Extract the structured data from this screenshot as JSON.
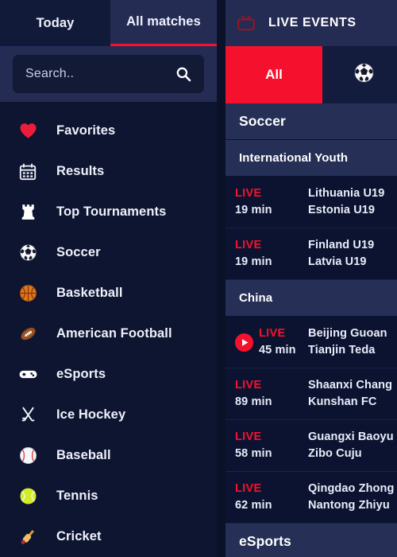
{
  "sidebar": {
    "tabs": [
      {
        "label": "Today",
        "active": false
      },
      {
        "label": "All matches",
        "active": true
      }
    ],
    "search": {
      "placeholder": "Search..",
      "value": "",
      "icon": "search-icon"
    },
    "items": [
      {
        "label": "Favorites",
        "icon": "heart-icon",
        "glyph": "❤️"
      },
      {
        "label": "Results",
        "icon": "calendar-icon",
        "glyph": "📅"
      },
      {
        "label": "Top Tournaments",
        "icon": "chess-rook-icon",
        "glyph": "♜"
      },
      {
        "label": "Soccer",
        "icon": "soccer-ball-icon",
        "glyph": "⚽"
      },
      {
        "label": "Basketball",
        "icon": "basketball-icon",
        "glyph": "🏀"
      },
      {
        "label": "American Football",
        "icon": "american-football-icon",
        "glyph": "🏈"
      },
      {
        "label": "eSports",
        "icon": "gamepad-icon",
        "glyph": "🎮"
      },
      {
        "label": "Ice Hockey",
        "icon": "ice-hockey-icon",
        "glyph": "🏒"
      },
      {
        "label": "Baseball",
        "icon": "baseball-icon",
        "glyph": "⚾"
      },
      {
        "label": "Tennis",
        "icon": "tennis-ball-icon",
        "glyph": "🎾"
      },
      {
        "label": "Cricket",
        "icon": "cricket-icon",
        "glyph": "🏏"
      }
    ]
  },
  "live_panel": {
    "header": {
      "title": "LIVE EVENTS",
      "icon": "tv-icon"
    },
    "sport_tabs": [
      {
        "label": "All",
        "icon": "",
        "active": true
      },
      {
        "label": "",
        "icon": "soccer-ball-icon",
        "glyph": "⚽",
        "active": false
      }
    ],
    "sections": [
      {
        "sport": "Soccer",
        "leagues": [
          {
            "name": "International Youth",
            "matches": [
              {
                "status": "LIVE",
                "minute": "19 min",
                "home": "Lithuania U19",
                "away": "Estonia U19",
                "has_stream": false
              },
              {
                "status": "LIVE",
                "minute": "19 min",
                "home": "Finland U19",
                "away": "Latvia U19",
                "has_stream": false
              }
            ]
          },
          {
            "name": "China",
            "matches": [
              {
                "status": "LIVE",
                "minute": "45 min",
                "home": "Beijing Guoan",
                "away": "Tianjin Teda",
                "has_stream": true
              },
              {
                "status": "LIVE",
                "minute": "89 min",
                "home": "Shaanxi Chang",
                "away": "Kunshan FC",
                "has_stream": false
              },
              {
                "status": "LIVE",
                "minute": "58 min",
                "home": "Guangxi Baoyu",
                "away": "Zibo Cuju",
                "has_stream": false
              },
              {
                "status": "LIVE",
                "minute": "62 min",
                "home": "Qingdao Zhong",
                "away": "Nantong Zhiyu",
                "has_stream": false
              }
            ]
          }
        ]
      },
      {
        "sport": "eSports",
        "leagues": []
      }
    ]
  },
  "colors": {
    "accent_red": "#f5112e",
    "panel_bg": "#0c1330",
    "sidebar_bg": "#0e1530",
    "header_bg": "#242c54",
    "section_bg": "#263056",
    "text": "#e9edfa"
  }
}
